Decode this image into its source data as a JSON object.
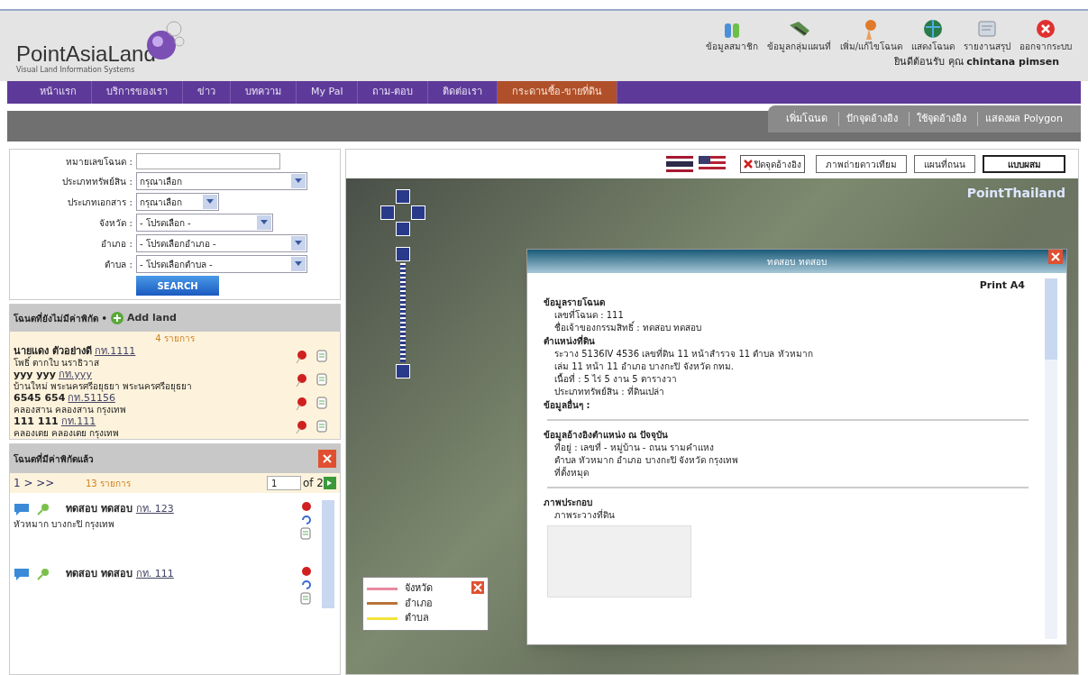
{
  "logo": {
    "name": "PointAsiaLand",
    "tagline": "Visual Land Information Systems"
  },
  "top_links": [
    {
      "label": "ข้อมูลสมาชิก",
      "kind": "members"
    },
    {
      "label": "ข้อมูลกลุ่มแผนที่",
      "kind": "maps"
    },
    {
      "label": "เพิ่ม/แก้ไขโฉนด",
      "kind": "edit"
    },
    {
      "label": "แสดงโฉนด",
      "kind": "globe"
    },
    {
      "label": "รายงานสรุป",
      "kind": "report"
    },
    {
      "label": "ออกจากระบบ",
      "kind": "logout"
    }
  ],
  "welcome": "ยินดีต้อนรับ คุณ **chintana pimsen**",
  "nav": [
    {
      "label": "หน้าแรก",
      "selected": false
    },
    {
      "label": "บริการของเรา",
      "selected": false
    },
    {
      "label": "ข่าว",
      "selected": false
    },
    {
      "label": "บทความ",
      "selected": false
    },
    {
      "label": "My Pal",
      "selected": false
    },
    {
      "label": "ถาม-ตอบ",
      "selected": false
    },
    {
      "label": "ติดต่อเรา",
      "selected": false
    },
    {
      "label": "กระดานซื้อ-ขายที่ดิน",
      "selected": true
    }
  ],
  "sub_tabs": [
    "เพิ่มโฉนด",
    "ปักจุดอ้างอิง",
    "ใช้จุดอ้างอิง",
    "แสดงผล Polygon"
  ],
  "search_form": {
    "fields": [
      {
        "label": "หมายเลขโฉนด :",
        "kind": "text"
      },
      {
        "label": "ประเภททรัพย์สิน :",
        "kind": "select",
        "value": "กรุณาเลือก"
      },
      {
        "label": "ประเภทเอกสาร :",
        "kind": "select",
        "value": "กรุณาเลือก"
      },
      {
        "label": "จังหวัด :",
        "kind": "select",
        "value": "- โปรดเลือก -"
      },
      {
        "label": "อำเภอ :",
        "kind": "select",
        "value": "- โปรดเลือกอำเภอ -"
      },
      {
        "label": "ตำบล :",
        "kind": "select",
        "value": "- โปรดเลือกตำบล -"
      }
    ],
    "button": "SEARCH"
  },
  "unlocated": {
    "title": "โฉนดที่ยังไม่มีค่าพิกัด •",
    "add_label": "Add land",
    "count": "4 รายการ",
    "items": [
      {
        "name": "นายแดง ตัวอย่างดี",
        "deed": "กท.1111",
        "place": "โพธิ์ ตากใบ นราธิวาส"
      },
      {
        "name": "yyy yyy",
        "deed": "กท.yyy",
        "place": "บ้านใหม่ พระนครศรีอยุธยา พระนครศรีอยุธยา"
      },
      {
        "name": "6545 654",
        "deed": "กท.51156",
        "place": "คลองสาน คลองสาน กรุงเทพ"
      },
      {
        "name": "111 111",
        "deed": "กท.111",
        "place": "คลองเตย คลองเตย กรุงเทพ"
      }
    ]
  },
  "located": {
    "title": "โฉนดที่มีค่าพิกัดแล้ว",
    "pager": "1 > >>",
    "count": "13 รายการ",
    "page": "1",
    "of": "of 2",
    "items": [
      {
        "name": "ทดสอบ ทดสอบ",
        "deed": "กท. 123",
        "place": "หัวหมาก บางกะปิ กรุงเทพ"
      },
      {
        "name": "ทดสอบ ทดสอบ",
        "deed": "กท. 111"
      }
    ]
  },
  "map": {
    "reference_toggle": "ปิดจุดอ้างอิง",
    "types": [
      {
        "label": "ภาพถ่ายดาวเทียม",
        "selected": false
      },
      {
        "label": "แผนที่ถนน",
        "selected": false
      },
      {
        "label": "แบบผสม",
        "selected": true
      }
    ],
    "brand": "PointThailand"
  },
  "legend": [
    {
      "label": "จังหวัด",
      "color": "#e88aa0"
    },
    {
      "label": "อำเภอ",
      "color": "#b8743a"
    },
    {
      "label": "ตำบล",
      "color": "#f2e23a"
    }
  ],
  "popup": {
    "title": "ทดสอบ ทดสอบ",
    "print": "Print A4",
    "sections": [
      {
        "heading": "ข้อมูลรายโฉนด",
        "lines": [
          "เลขที่โฉนด : 111",
          "ชื่อเจ้าของกรรมสิทธิ์ : ทดสอบ ทดสอบ"
        ],
        "divider": false
      },
      {
        "heading": "ตำแหน่งที่ดิน",
        "lines": [
          "ระวาง 5136IV 4536 เลขที่ดิน 11 หน้าสำรวจ 11 ตำบล หัวหมาก",
          "เล่ม 11 หน้า 11 อำเภอ บางกะปิ จังหวัด กทม.",
          "เนื้อที่ : 5 ไร่ 5 งาน 5 ตารางวา",
          "ประเภททรัพย์สิน : ที่ดินเปล่า"
        ],
        "divider": false
      },
      {
        "heading": "ข้อมูลอื่นๆ :",
        "divider": true
      },
      {
        "heading": "ข้อมูลอ้างอิงตำแหน่ง ณ ปัจจุบัน",
        "lines": [
          "ที่อยู่ : เลขที่ - หมู่บ้าน - ถนน รามคำแหง",
          "ตำบล หัวหมาก อำเภอ บางกะปิ จังหวัด กรุงเทพ",
          "ที่ตั้งหมุด"
        ],
        "divider": true
      },
      {
        "heading": "ภาพประกอบ",
        "lines": [
          "ภาพระวางที่ดิน"
        ],
        "divider": false
      }
    ]
  }
}
